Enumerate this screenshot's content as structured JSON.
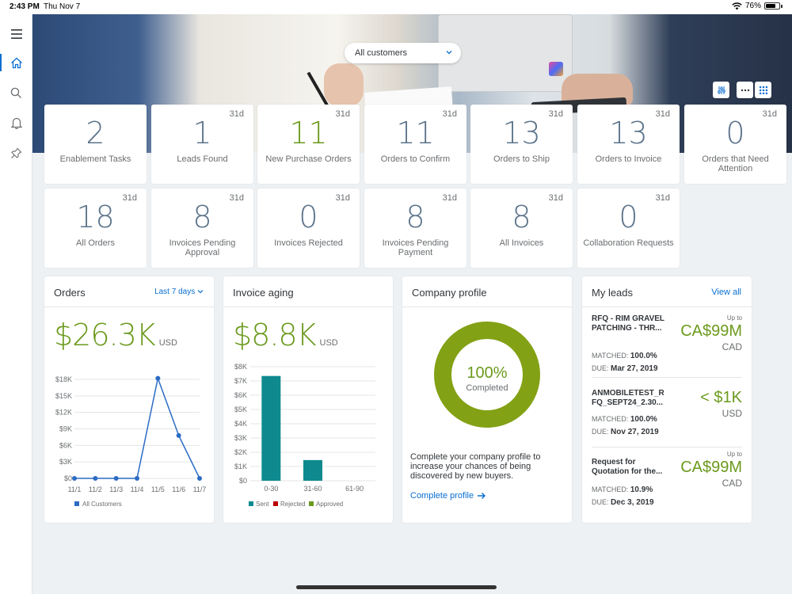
{
  "status": {
    "time": "2:43 PM",
    "date": "Thu Nov 7",
    "battery": "76%",
    "battery_level": 0.76
  },
  "customer_filter": {
    "value": "All customers"
  },
  "tiles": [
    {
      "value": "2",
      "label": "Enablement Tasks",
      "period": ""
    },
    {
      "value": "1",
      "label": "Leads Found",
      "period": "31d"
    },
    {
      "value": "11",
      "label": "New Purchase Orders",
      "period": "31d"
    },
    {
      "value": "11",
      "label": "Orders to Confirm",
      "period": "31d"
    },
    {
      "value": "13",
      "label": "Orders to Ship",
      "period": "31d"
    },
    {
      "value": "13",
      "label": "Orders to Invoice",
      "period": "31d"
    },
    {
      "value": "0",
      "label": "Orders that Need Attention",
      "period": "31d"
    },
    {
      "value": "18",
      "label": "All Orders",
      "period": "31d"
    },
    {
      "value": "8",
      "label": "Invoices Pending Approval",
      "period": "31d"
    },
    {
      "value": "0",
      "label": "Invoices Rejected",
      "period": "31d"
    },
    {
      "value": "8",
      "label": "Invoices Pending Payment",
      "period": "31d"
    },
    {
      "value": "8",
      "label": "All Invoices",
      "period": "31d"
    },
    {
      "value": "0",
      "label": "Collaboration Requests",
      "period": "31d"
    }
  ],
  "orders": {
    "title": "Orders",
    "range": "Last 7 days",
    "total": "$26.3K",
    "currency": "USD"
  },
  "invoice_aging": {
    "title": "Invoice aging",
    "total": "$8.8K",
    "currency": "USD"
  },
  "company_profile": {
    "title": "Company profile",
    "percent": "100%",
    "status": "Completed",
    "completion": 1.0,
    "text": "Complete your company profile to increase your chances of being discovered by new buyers.",
    "link": "Complete profile"
  },
  "leads": {
    "title": "My leads",
    "view_all": "View all",
    "matched_label": "MATCHED:",
    "due_label": "DUE:",
    "items": [
      {
        "title": "RFQ - RIM GRAVEL PATCHING - THR...",
        "matched": "100.0%",
        "due": "Mar 27, 2019",
        "upto": "Up to",
        "amount": "CA$99M",
        "currency": "CAD"
      },
      {
        "title": "ANMOBILETEST_R FQ_SEPT24_2.30...",
        "matched": "100.0%",
        "due": "Nov 27, 2019",
        "upto": "",
        "amount": "< $1K",
        "currency": "USD"
      },
      {
        "title": "Request for Quotation for the...",
        "matched": "10.9%",
        "due": "Dec 3, 2019",
        "upto": "Up to",
        "amount": "CA$99M",
        "currency": "CAD"
      }
    ]
  },
  "colors": {
    "accent": "#0a6ed1",
    "positive": "#6b9a1d",
    "sent": "#0e8a8f",
    "rejected": "#bb0000",
    "approved": "#6b9a1d",
    "series": "#2b6cc4"
  },
  "chart_data": [
    {
      "type": "line",
      "x": [
        "11/1",
        "11/2",
        "11/3",
        "11/4",
        "11/5",
        "11/6",
        "11/7"
      ],
      "series": [
        {
          "name": "All Customers",
          "values": [
            0,
            0,
            0,
            0,
            18200,
            7800,
            0
          ]
        }
      ],
      "yticks": [
        "$0",
        "$3K",
        "$6K",
        "$9K",
        "$12K",
        "$15K",
        "$18K"
      ],
      "ylim": [
        0,
        18000
      ],
      "grid": true,
      "legend": "bottom"
    },
    {
      "type": "bar",
      "categories": [
        "0-30",
        "31-60",
        "61-90"
      ],
      "series": [
        {
          "name": "Sent",
          "values": [
            7350,
            1450,
            0
          ]
        },
        {
          "name": "Rejected",
          "values": [
            0,
            0,
            0
          ]
        },
        {
          "name": "Approved",
          "values": [
            0,
            0,
            0
          ]
        }
      ],
      "yticks": [
        "$0",
        "$1K",
        "$2K",
        "$3K",
        "$4K",
        "$5K",
        "$6K",
        "$7K",
        "$8K"
      ],
      "ylim": [
        0,
        8000
      ],
      "grid": true,
      "legend": "bottom"
    }
  ]
}
